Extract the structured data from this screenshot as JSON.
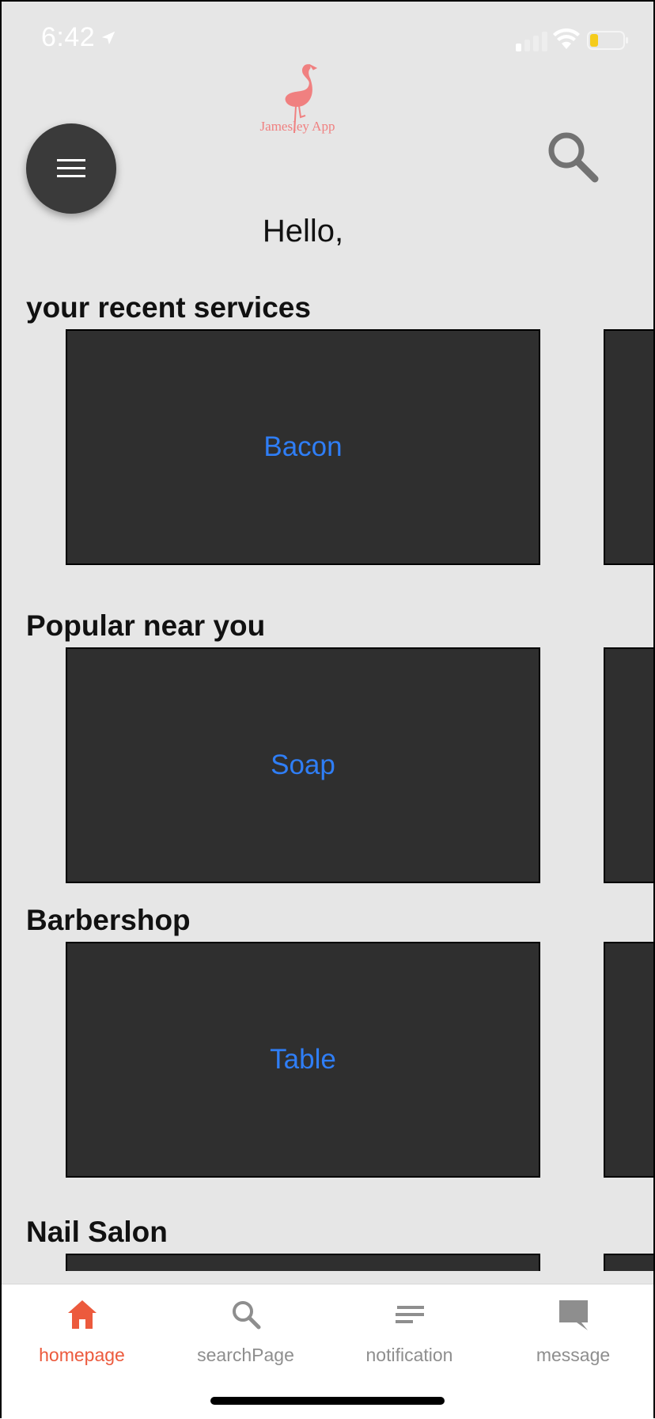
{
  "status_bar": {
    "time": "6:42"
  },
  "header": {
    "logo_text": "Jamesley App",
    "greeting": "Hello,"
  },
  "sections": [
    {
      "title": "your recent services",
      "card_label": "Bacon"
    },
    {
      "title": "Popular near you",
      "card_label": "Soap"
    },
    {
      "title": "Barbershop",
      "card_label": "Table"
    },
    {
      "title": "Nail Salon",
      "card_label": ""
    }
  ],
  "tabs": [
    {
      "label": "homepage",
      "icon": "home-icon",
      "active": true
    },
    {
      "label": "searchPage",
      "icon": "search-icon",
      "active": false
    },
    {
      "label": "notification",
      "icon": "notification-lines-icon",
      "active": false
    },
    {
      "label": "message",
      "icon": "message-icon",
      "active": false
    }
  ],
  "colors": {
    "background": "#e6e6e6",
    "card": "#2f2f2f",
    "card_label": "#2f7ef6",
    "accent": "#ec5a3d",
    "tab_inactive": "#8e8e8e",
    "logo": "#f08080"
  }
}
